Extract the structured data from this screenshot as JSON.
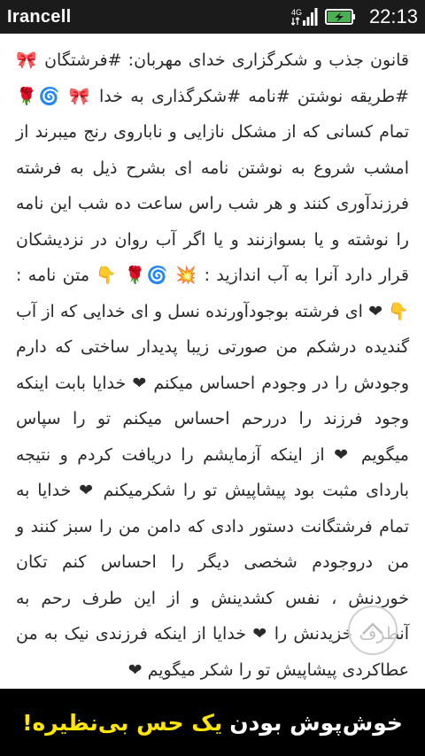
{
  "status_bar": {
    "carrier": "Irancell",
    "network_label": "4G",
    "time": "22:13"
  },
  "article": {
    "text": "قانون جذب و شکرگزاری خدای مهربان: #فرشتگان 🎀 #طریقه نوشتن #نامه #شکرگذاری به خدا 🎀 🌀🌹 تمام کسانی که از مشکل نازایی و ناباروی رنج میبرند از امشب شروع به نوشتن نامه ای بشرح ذیل به فرشته فرزندآوری کنند و هر شب راس ساعت ده شب این نامه را نوشته و یا بسوازنند و یا اگر آب روان در نزدیشکان قرار دارد آنرا به آب اندازید : 💥 🌀🌹 👇 متن نامه : 👇 ❤ ای فرشته بوجودآورنده نسل و ای خدایی که از آب گندیده درشکم من صورتی زیبا پدیدار ساختی که دارم وجودش را در وجودم احساس میکنم ❤ خدایا بابت اینکه وجود فرزند را دررحم احساس میکنم تو را سپاس میگویم ❤ از اینکه آزمایشم را دریافت کردم و نتیجه باردای مثبت بود پیشاپیش تو را شکرمیکنم ❤ خدایا به تمام فرشتگانت دستور دادی که دامن من را سبز کنند و من دروجودم شخصی دیگر را احساس کنم تکان خوردنش ، نفس کشدینش و از این طرف رحم به آنطرف خزیدنش را ❤ خدایا از اینکه فرزندی نیک به من عطاکردی پیشاپیش تو را شکر میگویم ❤"
  },
  "ad_banner": {
    "text_white": "خوش‌پوش بودن",
    "text_yellow": "یک حس بی‌نظیره!",
    "yellow_color": "#ffe600"
  },
  "icons": {
    "network": "4g-signal-icon",
    "signal": "signal-bars-icon",
    "battery": "battery-charging-icon",
    "scroll_top": "chevron-up-icon"
  }
}
